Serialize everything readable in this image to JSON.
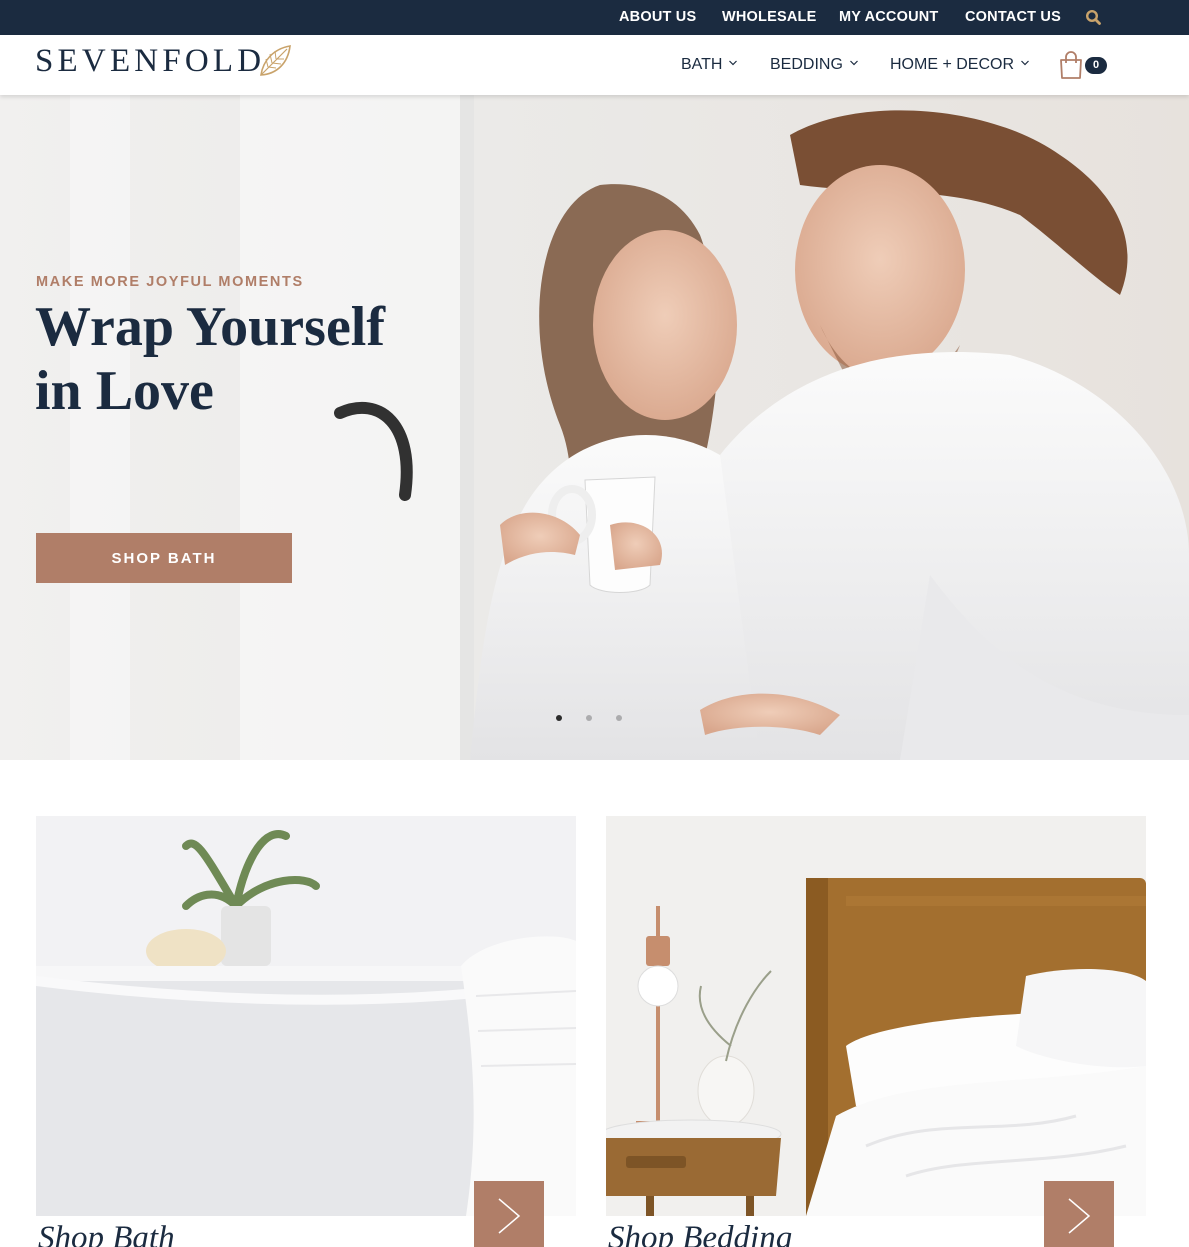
{
  "topbar": {
    "links": [
      "ABOUT US",
      "WHOLESALE",
      "MY ACCOUNT",
      "CONTACT US"
    ],
    "search_icon": "search-icon"
  },
  "header": {
    "logo_text": "SEVENFOLD",
    "nav": [
      "BATH",
      "BEDDING",
      "HOME + DECOR"
    ],
    "cart_count": "0"
  },
  "hero": {
    "eyebrow": "MAKE MORE  JOYFUL MOMENTS",
    "title_line1": "Wrap Yourself",
    "title_line2": "in Love",
    "cta": "SHOP BATH",
    "slides": 3,
    "active_slide": 1
  },
  "cards": [
    {
      "title": "Shop Bath"
    },
    {
      "title": "Shop Bedding"
    }
  ],
  "colors": {
    "navy": "#1b2b40",
    "accent": "#b07e68",
    "gold": "#c9a36b"
  }
}
